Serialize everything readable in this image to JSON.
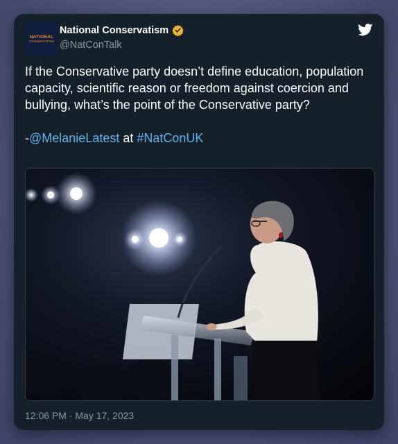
{
  "account": {
    "display_name": "National Conservatism",
    "handle": "@NatConTalk",
    "avatar_line1": "NATIONAL",
    "avatar_line2": "CONSERVATISM",
    "verified_color": "#e9b533"
  },
  "tweet": {
    "text": "If the Conservative party doesn’t define education, population capacity, scientific reason or freedom against coercion and bullying, what’s the point of the Conservative party?",
    "credit_prefix": "-",
    "mention": "@MelanieLatest",
    "credit_middle": " at ",
    "hashtag": "#NatConUK",
    "timestamp": "12:06 PM · May 17, 2023"
  },
  "media": {
    "description": "speaker-at-podium-photo"
  },
  "icons": {
    "brand": "twitter-bird-icon",
    "verified": "verified-badge-icon"
  },
  "colors": {
    "card_bg": "#15202b",
    "link": "#5fb3ee",
    "muted_text": "#8b98a5",
    "twitter_bird": "#ffffff"
  }
}
